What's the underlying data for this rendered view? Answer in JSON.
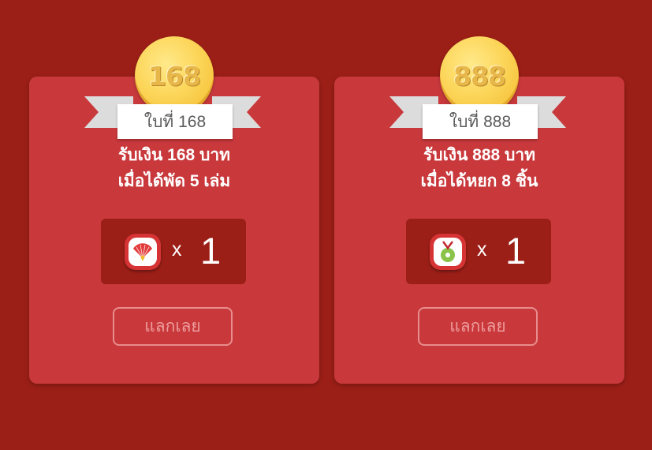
{
  "cards": [
    {
      "coin_value": "168",
      "ribbon_label": "ใบที่ 168",
      "line1": "รับเงิน 168 บาท",
      "line2": "เมื่อได้พัด 5 เล่ม",
      "item_icon": "fan-icon",
      "multiplier": "x",
      "count": "1",
      "button_label": "แลกเลย"
    },
    {
      "coin_value": "888",
      "ribbon_label": "ใบที่ 888",
      "line1": "รับเงิน 888 บาท",
      "line2": "เมื่อได้หยก 8 ชิ้น",
      "item_icon": "jade-pendant-icon",
      "multiplier": "x",
      "count": "1",
      "button_label": "แลกเลย"
    }
  ],
  "colors": {
    "background": "#9b1f17",
    "card": "#c9393c",
    "coin": "#fcd65a",
    "button_border": "#e88d8d"
  }
}
